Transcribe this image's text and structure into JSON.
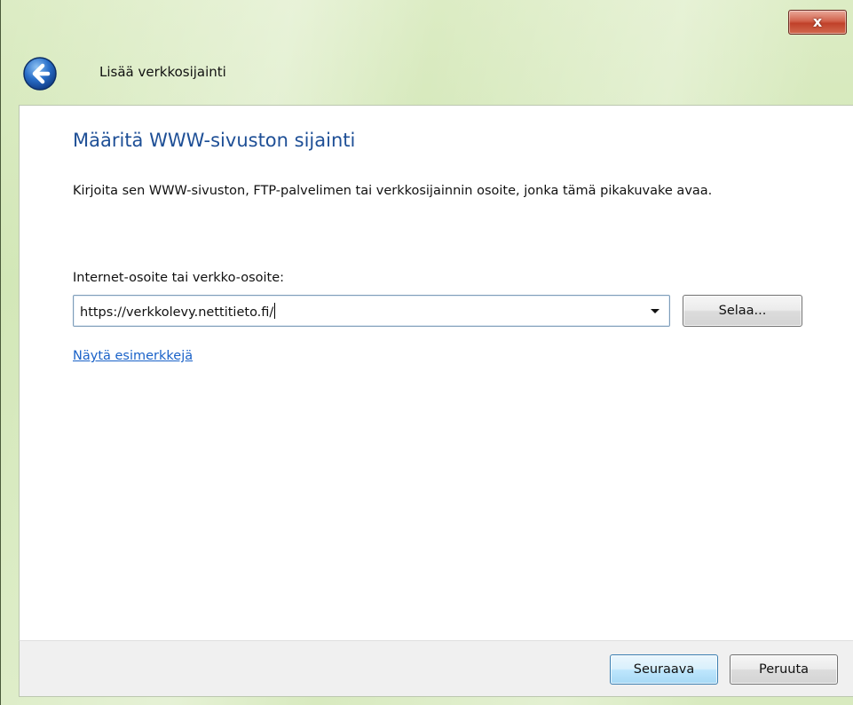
{
  "window": {
    "title": "Lisää verkkosijainti",
    "close_symbol": "x",
    "close_icon": "close-icon",
    "back_icon": "back-arrow-icon"
  },
  "main": {
    "heading": "Määritä WWW-sivuston sijainti",
    "description": "Kirjoita sen WWW-sivuston, FTP-palvelimen tai verkkosijainnin osoite, jonka tämä pikakuvake avaa.",
    "address_label": "Internet-osoite tai verkko-osoite:",
    "address_value": "https://verkkolevy.nettitieto.fi/",
    "browse_label": "Selaa...",
    "examples_link": "Näytä esimerkkejä"
  },
  "footer": {
    "next_label": "Seuraava",
    "cancel_label": "Peruuta"
  },
  "colors": {
    "heading": "#1e4f96",
    "link": "#1a62c8",
    "close_button": "#c0412a",
    "frame": "#d8eabf"
  }
}
